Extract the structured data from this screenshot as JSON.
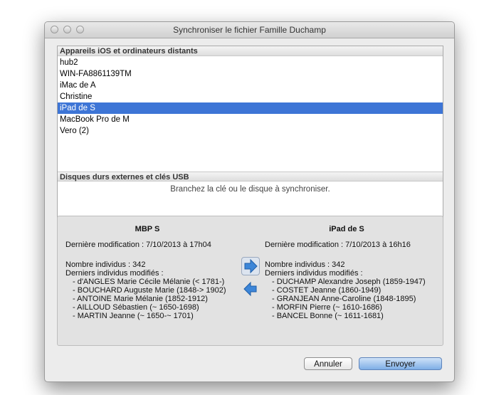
{
  "window": {
    "title": "Synchroniser le fichier  Famille Duchamp"
  },
  "devices": {
    "header": "Appareils iOS et ordinateurs distants",
    "items": [
      {
        "label": "hub2",
        "selected": false
      },
      {
        "label": "WIN-FA8861139TM",
        "selected": false
      },
      {
        "label": "iMac de A",
        "selected": false
      },
      {
        "label": "Christine",
        "selected": false
      },
      {
        "label": "iPad de S",
        "selected": true
      },
      {
        "label": "MacBook Pro de M",
        "selected": false
      },
      {
        "label": "Vero (2)",
        "selected": false
      }
    ]
  },
  "usb": {
    "header": "Disques durs externes et clés USB",
    "hint": "Branchez la clé ou le disque à synchroniser."
  },
  "left": {
    "name": "MBP S",
    "modified": "Dernière modification : 7/10/2013 à 17h04",
    "count": "Nombre individus : 342",
    "recent_label": "Derniers individus modifiés :",
    "recent": [
      "- d'ANGLES Marie Cécile Mélanie (< 1781-)",
      "- BOUCHARD Auguste Marie (1848-> 1902)",
      "- ANTOINE Marie Mélanie (1852-1912)",
      "- AILLOUD Sébastien (~ 1650-1698)",
      "- MARTIN Jeanne (~ 1650-~ 1701)"
    ]
  },
  "right": {
    "name": "iPad de S",
    "modified": "Dernière modification : 7/10/2013 à 16h16",
    "count": "Nombre individus : 342",
    "recent_label": "Derniers individus modifiés :",
    "recent": [
      "- DUCHAMP Alexandre Joseph (1859-1947)",
      "- COSTET Jeanne (1860-1949)",
      "- GRANJEAN Anne-Caroline (1848-1895)",
      "- MORFIN Pierre (~ 1610-1686)",
      "- BANCEL Bonne (~ 1611-1681)"
    ]
  },
  "buttons": {
    "cancel": "Annuler",
    "send": "Envoyer"
  },
  "colors": {
    "selection": "#3d75d6",
    "arrow": "#3d86d8",
    "default_button": "#7eaee6"
  },
  "icons": {
    "send": "arrow-right-icon",
    "receive": "arrow-left-icon"
  }
}
